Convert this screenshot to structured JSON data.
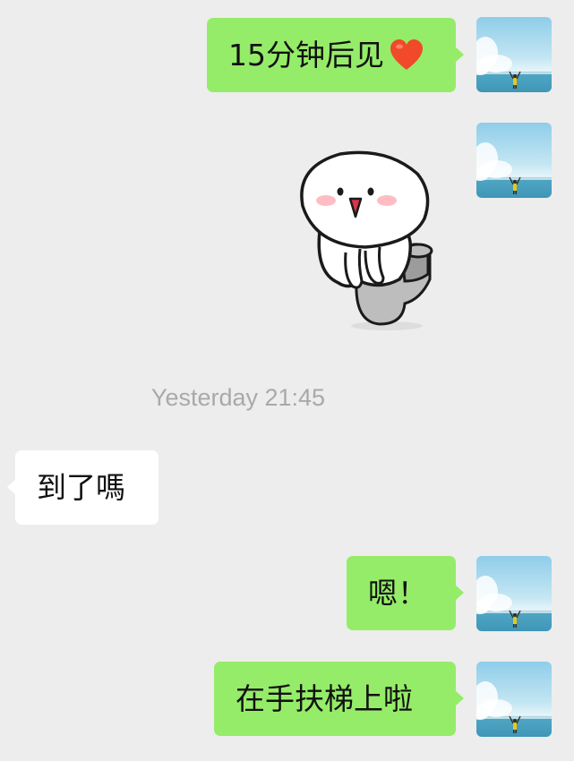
{
  "chat": {
    "timestamp": "Yesterday 21:45",
    "messages": [
      {
        "sender": "me",
        "type": "text",
        "text": "15分钟后见",
        "emoji": "red-heart"
      },
      {
        "sender": "me",
        "type": "sticker",
        "sticker": "round-face-sitting-on-toilet"
      },
      {
        "sender": "other",
        "type": "text",
        "text": "到了嗎"
      },
      {
        "sender": "me",
        "type": "text",
        "text": "嗯！"
      },
      {
        "sender": "me",
        "type": "text",
        "text": "在手扶梯上啦"
      }
    ]
  },
  "colors": {
    "background": "#ededed",
    "my_bubble": "#95ec69",
    "their_bubble": "#ffffff",
    "timestamp_text": "#a9a9a9"
  },
  "avatar": {
    "description_icon": "sky-sea-person-avatar"
  }
}
